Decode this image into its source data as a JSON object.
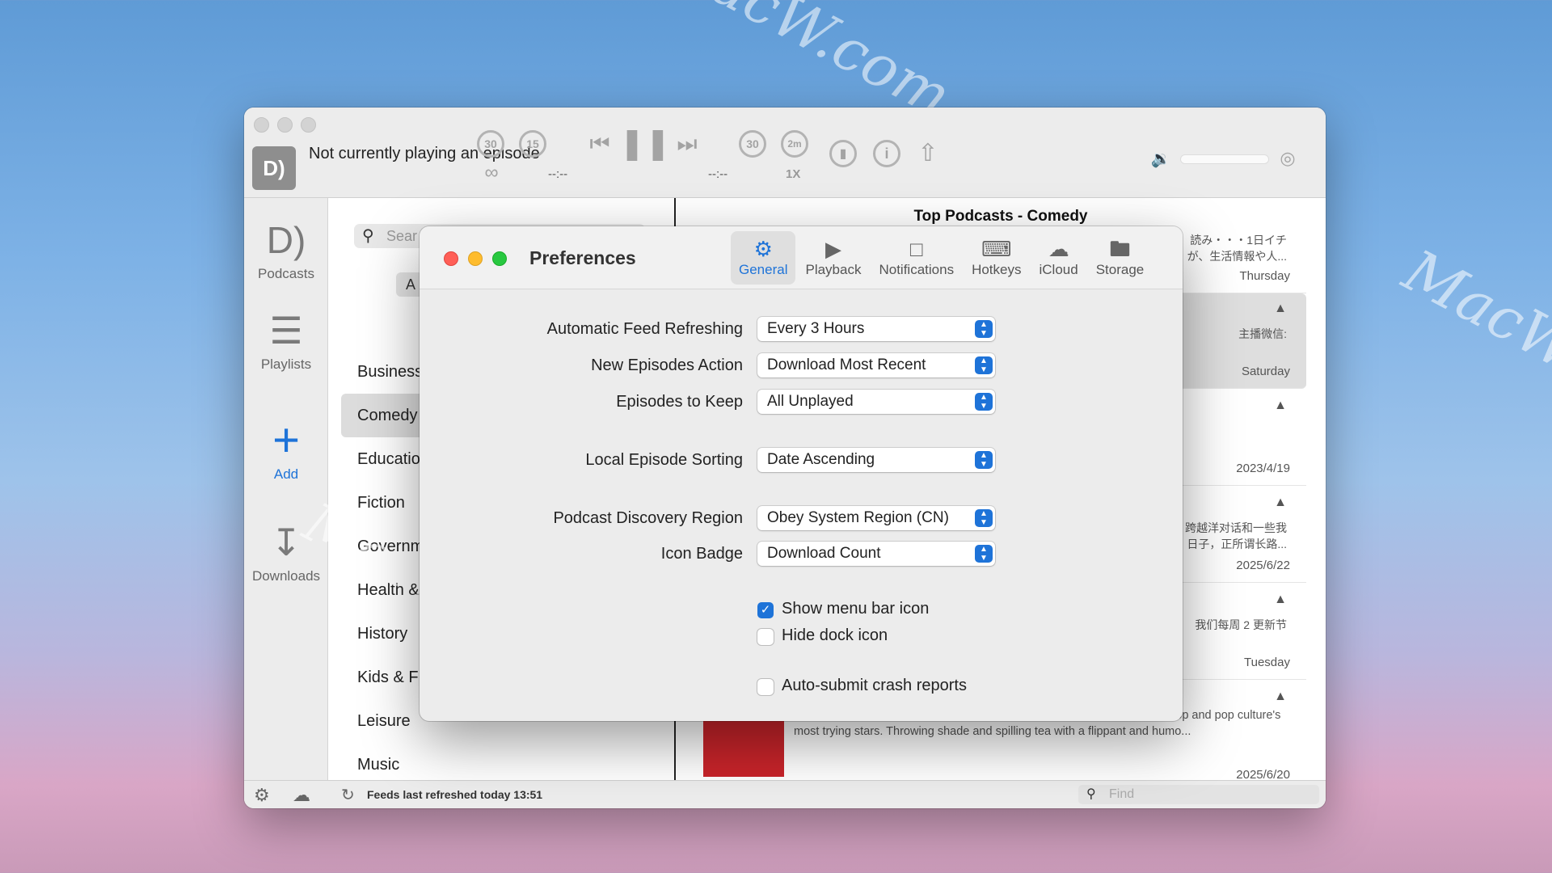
{
  "watermark": "MacW.com",
  "player": {
    "now_playing": "Not currently playing an episode",
    "skip_back_long": "30",
    "skip_back_short": "15",
    "skip_fwd_long": "30",
    "skip_fwd_short": "2m",
    "elapsed": "--:--",
    "remaining": "--:--",
    "speed": "1X"
  },
  "sidebar": {
    "items": [
      {
        "label": "Podcasts",
        "icon": "podcasts-icon"
      },
      {
        "label": "Playlists",
        "icon": "list-icon"
      },
      {
        "label": "Add",
        "icon": "plus-icon"
      },
      {
        "label": "Downloads",
        "icon": "tray-download-icon"
      }
    ]
  },
  "categories": {
    "search_placeholder": "Sear",
    "segment_label": "A",
    "items": [
      "Business",
      "Comedy",
      "Educatio",
      "Fiction",
      "Governm",
      "Health &",
      "History",
      "Kids & F",
      "Leisure",
      "Music"
    ],
    "selected": "Comedy"
  },
  "list": {
    "title": "Top Podcasts - Comedy",
    "episodes": [
      {
        "text": "読み・・・1日イチ\nが、生活情報や人...",
        "date": "Thursday"
      },
      {
        "text": "主播微信:",
        "date": "Saturday"
      },
      {
        "text": "",
        "date": "2023/4/19"
      },
      {
        "text": "跨越洋对话和一些我\n日子，正所谓长路...",
        "date": "2025/6/22"
      },
      {
        "text": "我们每周 2 更新节",
        "date": "Tuesday"
      },
      {
        "text": "Join bloggers Kid Fury and Crissle for their weekly podcast covering hip-hop and pop culture's most trying stars. Throwing shade and spilling tea with a flippant and humo...",
        "date": "2025/6/20"
      }
    ]
  },
  "status": {
    "refresh_text": "Feeds last refreshed today 13:51",
    "find_placeholder": "Find"
  },
  "prefs": {
    "title": "Preferences",
    "tabs": [
      {
        "label": "General",
        "icon": "gear-icon"
      },
      {
        "label": "Playback",
        "icon": "play-circle-icon"
      },
      {
        "label": "Notifications",
        "icon": "speech-bubble-icon"
      },
      {
        "label": "Hotkeys",
        "icon": "keyboard-icon"
      },
      {
        "label": "iCloud",
        "icon": "cloud-icon"
      },
      {
        "label": "Storage",
        "icon": "folder-icon"
      }
    ],
    "active_tab": "General",
    "fields": {
      "feed_refresh": {
        "label": "Automatic Feed Refreshing",
        "value": "Every 3 Hours"
      },
      "new_episodes": {
        "label": "New Episodes Action",
        "value": "Download Most Recent"
      },
      "keep": {
        "label": "Episodes to Keep",
        "value": "All Unplayed"
      },
      "sorting": {
        "label": "Local Episode Sorting",
        "value": "Date Ascending"
      },
      "region": {
        "label": "Podcast Discovery Region",
        "value": "Obey System Region (CN)"
      },
      "badge": {
        "label": "Icon Badge",
        "value": "Download Count"
      }
    },
    "checkboxes": {
      "menu_bar": {
        "label": "Show menu bar icon",
        "checked": true
      },
      "hide_dock": {
        "label": "Hide dock icon",
        "checked": false
      },
      "crash": {
        "label": "Auto-submit crash reports",
        "checked": false
      }
    }
  },
  "colors": {
    "accent": "#1e73d8",
    "close": "#ff5f57",
    "minimize": "#febc2e",
    "zoom": "#28c840"
  }
}
